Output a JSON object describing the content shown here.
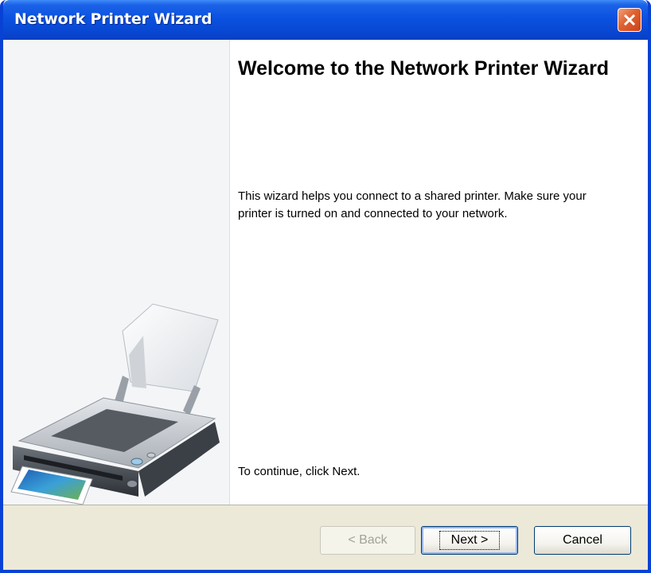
{
  "window": {
    "title": "Network Printer Wizard",
    "close_icon": "close-icon"
  },
  "side_panel": {
    "illustration": "printer-icon"
  },
  "content": {
    "heading": "Welcome to the Network Printer Wizard",
    "description": "This wizard helps you connect to a shared printer.  Make sure your printer is turned on and connected to your network.",
    "continue_text": "To continue, click Next."
  },
  "buttons": {
    "back_label": "< Back",
    "next_label": "Next >",
    "cancel_label": "Cancel",
    "back_enabled": false
  },
  "colors": {
    "titlebar": "#0a52e0",
    "close_button": "#e0602f",
    "button_bar": "#ece9d8"
  }
}
